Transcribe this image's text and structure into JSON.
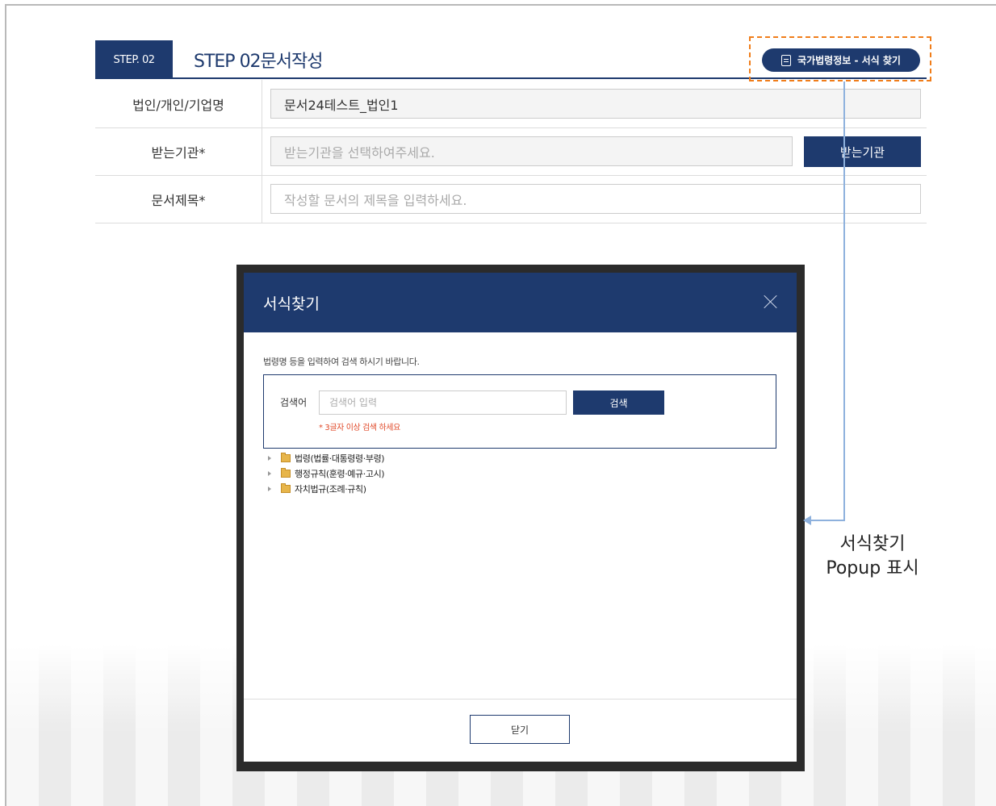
{
  "step": {
    "tab_label": "STEP. 02",
    "title": "STEP 02문서작성"
  },
  "law_button": {
    "label": "국가법령정보 - 서식 찾기",
    "icon": "document-icon"
  },
  "form": {
    "rows": [
      {
        "label": "법인/개인/기업명",
        "value": "문서24테스트_법인1"
      },
      {
        "label": "받는기관*",
        "placeholder": "받는기관을 선택하여주세요.",
        "button": "받는기관"
      },
      {
        "label": "문서제목*",
        "placeholder": "작성할 문서의 제목을 입력하세요."
      }
    ]
  },
  "annotation": {
    "line1": "서식찾기",
    "line2": "Popup 표시"
  },
  "popup": {
    "title": "서식찾기",
    "guide": "법령명 등을 입력하여 검색 하시기 바랍니다.",
    "search_label": "검색어",
    "search_placeholder": "검색어 입력",
    "search_button": "검색",
    "hint": "* 3글자 이상 검색 하세요",
    "tree": [
      {
        "label": "법령(법률·대통령령·부령)"
      },
      {
        "label": "행정규칙(훈령·예규·고시)"
      },
      {
        "label": "자치법규(조례·규칙)"
      }
    ],
    "close_button": "닫기"
  },
  "colors": {
    "primary": "#1e3a6e",
    "highlight": "#f07d1a",
    "connector": "#8eb1dd",
    "hint": "#e04a2a"
  }
}
